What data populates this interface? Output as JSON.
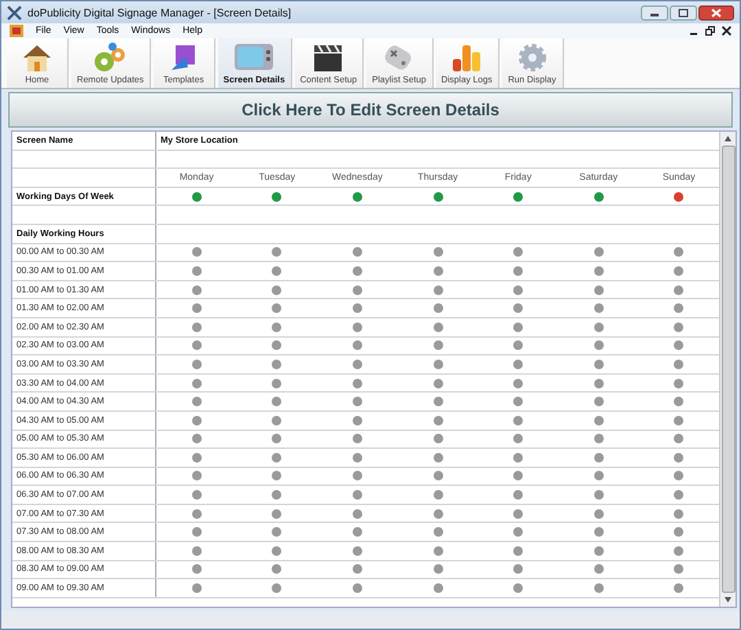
{
  "window": {
    "title": "doPublicity Digital Signage Manager - [Screen Details]"
  },
  "menu": [
    "File",
    "View",
    "Tools",
    "Windows",
    "Help"
  ],
  "toolbar": [
    {
      "label": "Home",
      "kind": "home",
      "selected": false
    },
    {
      "label": "Remote Updates",
      "kind": "gears",
      "selected": false
    },
    {
      "label": "Templates",
      "kind": "templates",
      "selected": false
    },
    {
      "label": "Screen Details",
      "kind": "tv",
      "selected": true
    },
    {
      "label": "Content Setup",
      "kind": "clapper",
      "selected": false
    },
    {
      "label": "Playlist Setup",
      "kind": "gamepad",
      "selected": false
    },
    {
      "label": "Display Logs",
      "kind": "chart",
      "selected": false
    },
    {
      "label": "Run Display",
      "kind": "gear",
      "selected": false
    }
  ],
  "edit_button": "Click Here To Edit Screen Details",
  "screen_name": {
    "label": "Screen Name",
    "value": "My Store Location"
  },
  "days": [
    "Monday",
    "Tuesday",
    "Wednesday",
    "Thursday",
    "Friday",
    "Saturday",
    "Sunday"
  ],
  "working_days": {
    "label": "Working Days Of Week",
    "states": [
      {
        "on": true
      },
      {
        "on": true
      },
      {
        "on": true
      },
      {
        "on": true
      },
      {
        "on": true
      },
      {
        "on": true
      },
      {
        "on": false
      }
    ]
  },
  "hours_heading": "Daily Working Hours",
  "hours": [
    {
      "label": "00.00 AM to 00.30 AM",
      "slots": [
        false,
        false,
        false,
        false,
        false,
        false,
        false
      ]
    },
    {
      "label": "00.30 AM to 01.00 AM",
      "slots": [
        false,
        false,
        false,
        false,
        false,
        false,
        false
      ]
    },
    {
      "label": "01.00 AM to 01.30 AM",
      "slots": [
        false,
        false,
        false,
        false,
        false,
        false,
        false
      ]
    },
    {
      "label": "01.30 AM to 02.00 AM",
      "slots": [
        false,
        false,
        false,
        false,
        false,
        false,
        false
      ]
    },
    {
      "label": "02.00 AM to 02.30 AM",
      "slots": [
        false,
        false,
        false,
        false,
        false,
        false,
        false
      ]
    },
    {
      "label": "02.30 AM to 03.00 AM",
      "slots": [
        false,
        false,
        false,
        false,
        false,
        false,
        false
      ]
    },
    {
      "label": "03.00 AM to 03.30 AM",
      "slots": [
        false,
        false,
        false,
        false,
        false,
        false,
        false
      ]
    },
    {
      "label": "03.30 AM to 04.00 AM",
      "slots": [
        false,
        false,
        false,
        false,
        false,
        false,
        false
      ]
    },
    {
      "label": "04.00 AM to 04.30 AM",
      "slots": [
        false,
        false,
        false,
        false,
        false,
        false,
        false
      ]
    },
    {
      "label": "04.30 AM to 05.00 AM",
      "slots": [
        false,
        false,
        false,
        false,
        false,
        false,
        false
      ]
    },
    {
      "label": "05.00 AM to 05.30 AM",
      "slots": [
        false,
        false,
        false,
        false,
        false,
        false,
        false
      ]
    },
    {
      "label": "05.30 AM to 06.00 AM",
      "slots": [
        false,
        false,
        false,
        false,
        false,
        false,
        false
      ]
    },
    {
      "label": "06.00 AM to 06.30 AM",
      "slots": [
        false,
        false,
        false,
        false,
        false,
        false,
        false
      ]
    },
    {
      "label": "06.30 AM to 07.00 AM",
      "slots": [
        false,
        false,
        false,
        false,
        false,
        false,
        false
      ]
    },
    {
      "label": "07.00 AM to 07.30 AM",
      "slots": [
        false,
        false,
        false,
        false,
        false,
        false,
        false
      ]
    },
    {
      "label": "07.30 AM to 08.00 AM",
      "slots": [
        false,
        false,
        false,
        false,
        false,
        false,
        false
      ]
    },
    {
      "label": "08.00 AM to 08.30 AM",
      "slots": [
        false,
        false,
        false,
        false,
        false,
        false,
        false
      ]
    },
    {
      "label": "08.30 AM to 09.00 AM",
      "slots": [
        false,
        false,
        false,
        false,
        false,
        false,
        false
      ]
    },
    {
      "label": "09.00 AM to 09.30 AM",
      "slots": [
        false,
        false,
        false,
        false,
        false,
        false,
        false
      ]
    }
  ]
}
